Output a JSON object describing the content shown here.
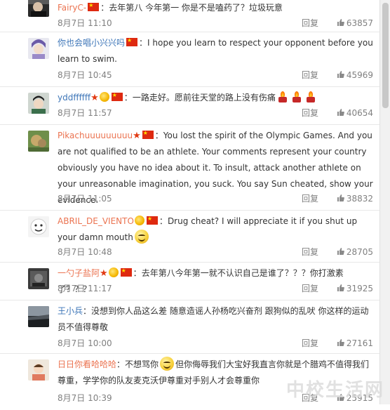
{
  "comments": [
    {
      "user": "FairyC-",
      "sep": "：",
      "text": "去年第八 今年第一 你是不是嗑药了？垃圾玩意",
      "time": "8月7日 11:10",
      "reply": "回复",
      "likes": "63857"
    },
    {
      "user": "你也会唱小兴兴吗",
      "sep": "：",
      "text": "I hope you learn to respect your opponent before you learn to swim.",
      "time": "8月7日 10:45",
      "reply": "回复",
      "likes": "45969"
    },
    {
      "user": "yddffffff",
      "sep": "：",
      "text": "一路走好。愿前往天堂的路上没有伤痛",
      "time": "8月7日 11:57",
      "reply": "回复",
      "likes": "40654"
    },
    {
      "user": "Pikachuuuuuuuuu",
      "sep": "：",
      "text": "You lost the spirit of the Olympic Games. And you are not qualified to be an athlete. Your comments represent your country obviously you have no idea about it. To insult, attack another athlete on your unreasonable imagination, you suck. You say Sun cheated, show your evidence.",
      "time": "8月7日 11:05",
      "reply": "回复",
      "likes": "38832"
    },
    {
      "user": "ABRIL_DE_VIENTO",
      "sep": "：",
      "text": "Drug cheat? I will appreciate it if you shut up your damn mouth",
      "time": "8月7日 10:48",
      "reply": "回复",
      "likes": "28705"
    },
    {
      "user": "一勺子盐阿",
      "sep": "：",
      "text": "去年第八今年第一就不认识自己是谁了？？？你打激素了？？？",
      "time": "8月7日 11:17",
      "reply": "回复",
      "likes": "31925"
    },
    {
      "user": "王小兵",
      "sep": "：",
      "text": "没想到你人品这么差 随意造谣人孙杨吃兴奋剂 跟狗似的乱吠 你这样的运动员不值得尊敬",
      "time": "8月7日 10:00",
      "reply": "回复",
      "likes": "27161"
    },
    {
      "user": "日日你看哈哈哈",
      "sep": "：",
      "text_a": "不想骂你",
      "text_b": "但你侮辱我们大宝好我直言你就是个腊鸡不值得我们尊重，学学你的队友麦克沃伊尊重对手别人才会尊重你",
      "time": "8月7日 10:39",
      "reply": "回复",
      "likes": "25915"
    }
  ],
  "watermark": "中校生活网",
  "colors": {
    "username_orange": "#eb7350",
    "username_blue": "#3e76b8",
    "meta_gray": "#808080",
    "flag_red": "#de2910"
  }
}
